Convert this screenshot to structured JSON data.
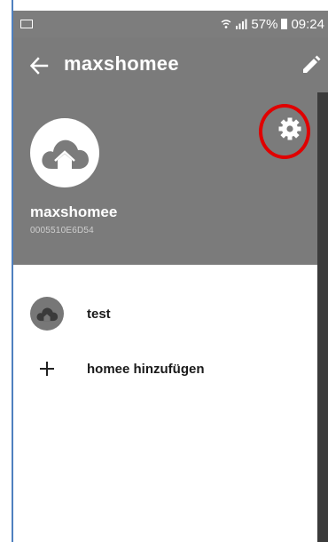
{
  "status_bar": {
    "battery_percent": "57%",
    "time": "09:24",
    "icons": [
      "image-notification-icon",
      "wifi-icon",
      "signal-icon",
      "battery-icon"
    ]
  },
  "app_bar": {
    "title": "maxshomee",
    "back_icon": "arrow-left-icon",
    "edit_icon": "pencil-icon"
  },
  "profile": {
    "name": "maxshomee",
    "id": "0005510E6D54",
    "avatar_icon": "cloud-home-icon",
    "settings_icon": "gear-icon"
  },
  "list": {
    "items": [
      {
        "label": "test",
        "icon": "cloud-home-icon"
      },
      {
        "label": "homee hinzufügen",
        "icon": "plus-icon"
      }
    ]
  },
  "colors": {
    "header_bg": "#7b7b7b",
    "status_bg": "#7d7d7d",
    "highlight_circle": "#e00000",
    "frame_blue": "#4f80bf",
    "scrim": "#3b3b3b"
  }
}
